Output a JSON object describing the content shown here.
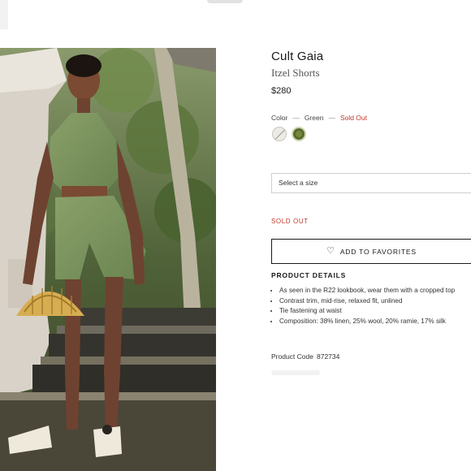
{
  "product": {
    "brand": "Cult Gaia",
    "name": "Itzel Shorts",
    "price": "$280"
  },
  "color": {
    "label": "Color",
    "separator": "—",
    "selected": "Green",
    "status": "Sold Out",
    "swatches": [
      {
        "name": "cream",
        "color": "#ecebe4"
      },
      {
        "name": "green",
        "color": "#5b6b2c"
      }
    ]
  },
  "size": {
    "placeholder": "Select a size"
  },
  "availability": {
    "label": "SOLD OUT",
    "color": "#c0392b"
  },
  "actions": {
    "favorites_label": "ADD TO FAVORITES",
    "favorites_icon": "heart-icon"
  },
  "details": {
    "title": "PRODUCT DETAILS",
    "items": [
      "As seen in the R22 lookbook, wear them with a cropped top",
      "Contrast trim, mid-rise, relaxed fit, unlined",
      "Tie fastening at waist",
      "Composition: 38% linen, 25% wool, 20% ramie, 17% silk"
    ]
  },
  "code": {
    "label": "Product Code",
    "value": "872734"
  }
}
